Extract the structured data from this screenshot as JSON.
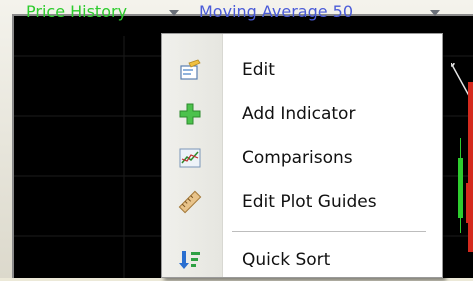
{
  "chart_header": {
    "price_history": "Price History",
    "moving_average": "Moving Average 50"
  },
  "context_menu": {
    "items": [
      {
        "label": "Edit",
        "icon": "edit-icon"
      },
      {
        "label": "Add Indicator",
        "icon": "add-indicator-icon"
      },
      {
        "label": "Comparisons",
        "icon": "comparisons-icon"
      },
      {
        "label": "Edit Plot Guides",
        "icon": "plot-guides-icon"
      },
      {
        "label": "Quick Sort",
        "icon": "quick-sort-icon"
      }
    ]
  },
  "colors": {
    "price_history": "#2ecc2e",
    "moving_average": "#4a5bd8",
    "chart_background": "#000000",
    "candle_up": "#2ecc2e",
    "candle_down": "#d42a1e"
  }
}
